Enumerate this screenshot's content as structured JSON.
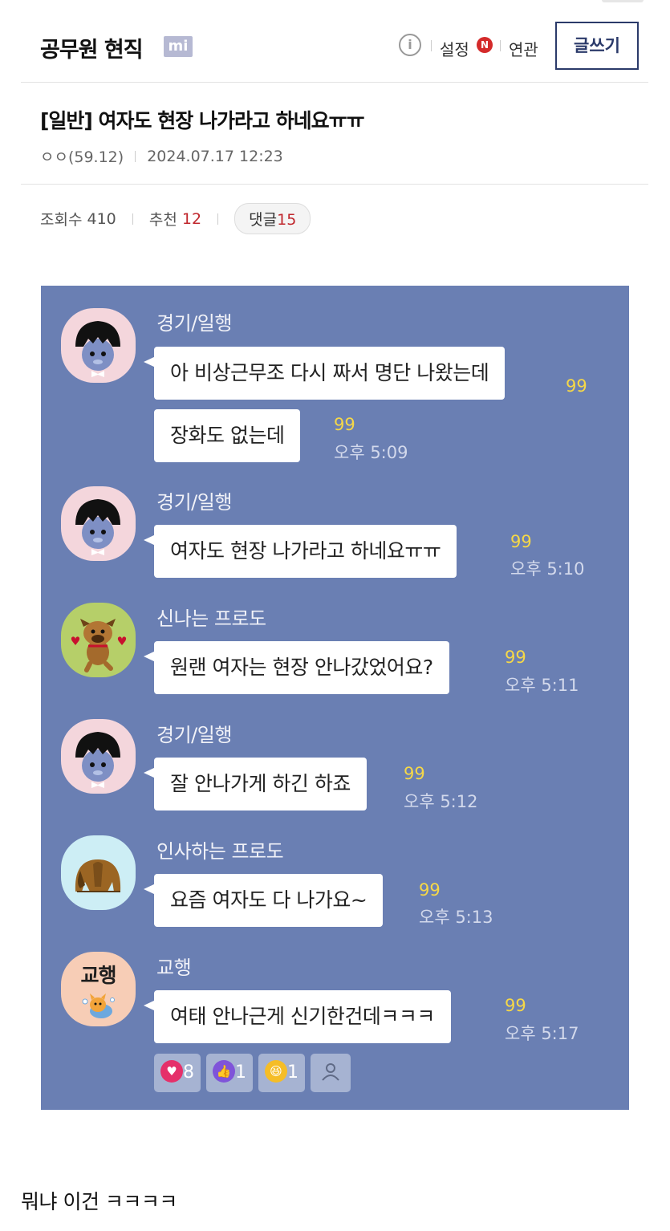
{
  "header": {
    "gallery_title": "공무원 현직",
    "gallery_badge": "mi",
    "info_icon": "info-icon",
    "settings_label": "설정",
    "settings_badge": "N",
    "related_label": "연관",
    "write_button": "글쓰기"
  },
  "post": {
    "title": "[일반] 여자도 현장 나가라고 하네요ㅠㅠ",
    "author": "ㅇㅇ(59.12)",
    "date": "2024.07.17 12:23",
    "views_label": "조회수",
    "views": "410",
    "recommend_label": "추천",
    "recommend": "12",
    "comments_label": "댓글",
    "comments": "15",
    "body_text": "뭐냐 이건 ㅋㅋㅋㅋ"
  },
  "chat": {
    "background": "#6a7fb3",
    "messages": [
      {
        "sender": "경기/일행",
        "avatar_icon": "black-hair-character-icon",
        "text": "아 비상근무조 다시 짜서 명단 나왔는데",
        "unread": "99"
      },
      {
        "text": "장화도 없는데",
        "unread": "99",
        "time": "오후 5:09"
      },
      {
        "sender": "경기/일행",
        "avatar_icon": "black-hair-character-icon",
        "text": "여자도 현장 나가라고 하네요ㅠㅠ",
        "unread": "99",
        "time": "오후 5:10"
      },
      {
        "sender": "신나는 프로도",
        "avatar_icon": "dancing-dog-icon",
        "text": "원랜 여자는 현장 안나갔었어요?",
        "unread": "99",
        "time": "오후 5:11"
      },
      {
        "sender": "경기/일행",
        "avatar_icon": "black-hair-character-icon",
        "text": "잘 안나가게 하긴 하죠",
        "unread": "99",
        "time": "오후 5:12"
      },
      {
        "sender": "인사하는 프로도",
        "avatar_icon": "bowing-dog-icon",
        "text": "요즘 여자도 다 나가요~",
        "unread": "99",
        "time": "오후 5:13"
      },
      {
        "sender": "교행",
        "avatar_label": "교행",
        "avatar_icon": "cat-character-icon",
        "text": "여태 안나근게 신기한건데ㅋㅋㅋ",
        "unread": "99",
        "time": "오후 5:17"
      }
    ],
    "reactions": [
      {
        "icon": "heart-icon",
        "count": "8"
      },
      {
        "icon": "thumbs-up-icon",
        "count": "1"
      },
      {
        "icon": "laughing-face-icon",
        "count": "1"
      },
      {
        "icon": "person-icon",
        "count": ""
      }
    ]
  }
}
